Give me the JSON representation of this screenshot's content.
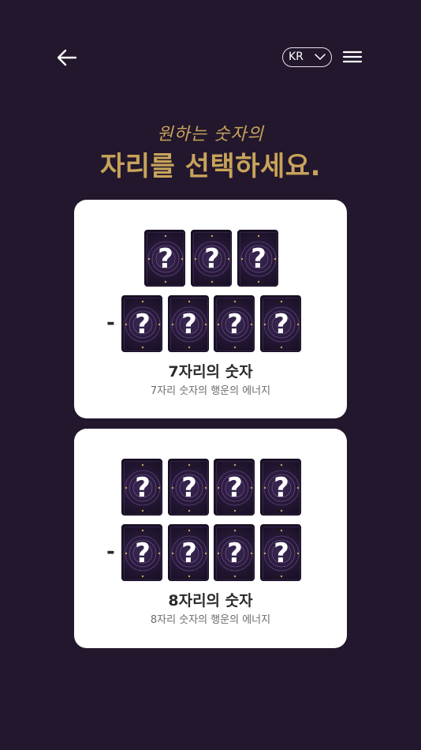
{
  "header": {
    "language": "KR"
  },
  "hero": {
    "subtitle": "원하는 숫자의",
    "title": "자리를 선택하세요."
  },
  "tile": {
    "symbol": "?"
  },
  "options": [
    {
      "title": "7자리의 숫자",
      "description": "7자리 숫자의 행운의 에너지",
      "prefix": "-"
    },
    {
      "title": "8자리의 숫자",
      "description": "8자리 숫자의 행운의 에너지",
      "prefix": "-"
    }
  ],
  "colors": {
    "background": "#22172c",
    "accent_gold": "#c8a35b",
    "card_bg": "#ffffff",
    "tile_dark": "#231733"
  },
  "icons": {
    "back": "arrow-left-icon",
    "language_dropdown": "chevron-down-icon",
    "menu": "hamburger-menu-icon"
  }
}
